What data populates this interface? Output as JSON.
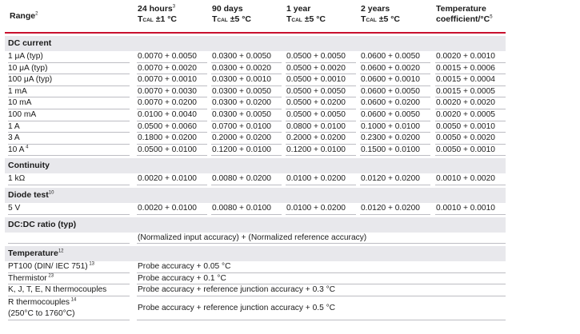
{
  "header": {
    "range_label": "Range",
    "range_note": "2",
    "columns": [
      {
        "title": "24 hours",
        "note": "3",
        "tcal": "±1 °C"
      },
      {
        "title": "90 days",
        "note": "",
        "tcal": "±5 °C"
      },
      {
        "title": "1 year",
        "note": "",
        "tcal": "±5 °C"
      },
      {
        "title": "2 years",
        "note": "",
        "tcal": "±5 °C"
      },
      {
        "title": "Temperature",
        "title2": "coefficient/°C",
        "note": "5",
        "tcal": ""
      }
    ],
    "tcal_prefix": "T",
    "tcal_sub": "CAL"
  },
  "dc_current": {
    "title": "DC current",
    "rows": [
      {
        "label": "1 μA (typ)",
        "note": "",
        "values": [
          "0.0070 + 0.0050",
          "0.0300 + 0.0050",
          "0.0500 + 0.0050",
          "0.0600 + 0.0050",
          "0.0020 + 0.0010"
        ]
      },
      {
        "label": "10 μA (typ)",
        "note": "",
        "values": [
          "0.0070 + 0.0020",
          "0.0300 + 0.0020",
          "0.0500 + 0.0020",
          "0.0600 + 0.0020",
          "0.0015 + 0.0006"
        ]
      },
      {
        "label": "100 μA (typ)",
        "note": "",
        "values": [
          "0.0070 + 0.0010",
          "0.0300 + 0.0010",
          "0.0500 + 0.0010",
          "0.0600 + 0.0010",
          "0.0015 + 0.0004"
        ]
      },
      {
        "label": "1 mA",
        "note": "",
        "values": [
          "0.0070 + 0.0030",
          "0.0300 + 0.0050",
          "0.0500 + 0.0050",
          "0.0600 + 0.0050",
          "0.0015 + 0.0005"
        ]
      },
      {
        "label": "10 mA",
        "note": "",
        "values": [
          "0.0070 + 0.0200",
          "0.0300 + 0.0200",
          "0.0500 + 0.0200",
          "0.0600 + 0.0200",
          "0.0020 + 0.0020"
        ]
      },
      {
        "label": "100 mA",
        "note": "",
        "values": [
          "0.0100 + 0.0040",
          "0.0300 + 0.0050",
          "0.0500 + 0.0050",
          "0.0600 + 0.0050",
          "0.0020 + 0.0005"
        ]
      },
      {
        "label": "1 A",
        "note": "",
        "values": [
          "0.0500 + 0.0060",
          "0.0700 + 0.0100",
          "0.0800 + 0.0100",
          "0.1000 + 0.0100",
          "0.0050 + 0.0010"
        ]
      },
      {
        "label": "3 A",
        "note": "",
        "values": [
          "0.1800 + 0.0200",
          "0.2000 + 0.0200",
          "0.2000 + 0.0200",
          "0.2300 + 0.0200",
          "0.0050 + 0.0020"
        ]
      },
      {
        "label": "10 A",
        "note": "4",
        "values": [
          "0.0500 + 0.0100",
          "0.1200 + 0.0100",
          "0.1200 + 0.0100",
          "0.1500 + 0.0100",
          "0.0050 + 0.0010"
        ]
      }
    ]
  },
  "continuity": {
    "title": "Continuity",
    "rows": [
      {
        "label": "1 kΩ",
        "note": "",
        "values": [
          "0.0020 + 0.0100",
          "0.0080 + 0.0200",
          "0.0100 + 0.0200",
          "0.0120 + 0.0200",
          "0.0010 + 0.0020"
        ]
      }
    ]
  },
  "diode_test": {
    "title": "Diode test",
    "note": "10",
    "rows": [
      {
        "label": "5 V",
        "note": "",
        "values": [
          "0.0020 + 0.0100",
          "0.0080 + 0.0100",
          "0.0100 + 0.0200",
          "0.0120 + 0.0200",
          "0.0010 + 0.0010"
        ]
      }
    ]
  },
  "dcdc_ratio": {
    "title": "DC:DC ratio (typ)",
    "text": "(Normalized input accuracy) + (Normalized reference accuracy)"
  },
  "temperature": {
    "title": "Temperature",
    "note": "12",
    "rows": [
      {
        "label": "PT100 (DIN/ IEC 751)",
        "note": "13",
        "text": "Probe accuracy + 0.05 °C"
      },
      {
        "label": "Thermistor",
        "note": "23",
        "text": "Probe accuracy + 0.1 °C"
      },
      {
        "label": "K, J, T, E, N thermocouples",
        "note": "",
        "text": "Probe accuracy + reference junction accuracy + 0.3 °C"
      },
      {
        "label": "R thermocouples",
        "label2": "(250°C to 1760°C)",
        "note": "14",
        "text": "Probe accuracy + reference junction accuracy + 0.5 °C"
      }
    ]
  },
  "colors": {
    "accent": "#c8102e",
    "section_bg": "#e8e8ec",
    "rule": "#bdbdc3"
  }
}
